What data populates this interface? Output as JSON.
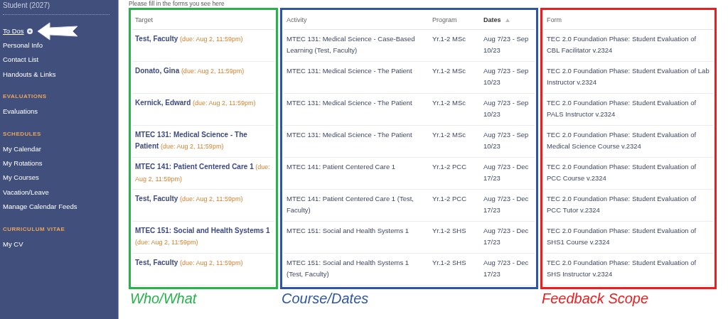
{
  "sidebar": {
    "user": "Student (2027)",
    "items": [
      {
        "kind": "badge-link",
        "label": "To Dos",
        "selected": true
      },
      {
        "kind": "link",
        "label": "Personal Info",
        "selected": false
      },
      {
        "kind": "link",
        "label": "Contact List",
        "selected": false
      },
      {
        "kind": "link",
        "label": "Handouts & Links",
        "selected": false
      },
      {
        "kind": "heading",
        "label": "EVALUATIONS"
      },
      {
        "kind": "link",
        "label": "Evaluations",
        "selected": false
      },
      {
        "kind": "heading",
        "label": "SCHEDULES"
      },
      {
        "kind": "link",
        "label": "My Calendar",
        "selected": false
      },
      {
        "kind": "link",
        "label": "My Rotations",
        "selected": false
      },
      {
        "kind": "link",
        "label": "My Courses",
        "selected": false
      },
      {
        "kind": "link",
        "label": "Vacation/Leave",
        "selected": false
      },
      {
        "kind": "link",
        "label": "Manage Calendar Feeds",
        "selected": false
      },
      {
        "kind": "heading",
        "label": "CURRICULUM VITAE"
      },
      {
        "kind": "link",
        "label": "My CV",
        "selected": false
      }
    ]
  },
  "intro": "Please fill in the forms you see here",
  "table": {
    "columns": [
      {
        "label": "Target",
        "sorted": false
      },
      {
        "label": "Activity",
        "sorted": false
      },
      {
        "label": "Program",
        "sorted": false
      },
      {
        "label": "Dates",
        "sorted": true
      },
      {
        "label": "Form",
        "sorted": false
      }
    ],
    "rows": [
      {
        "target": "Test, Faculty",
        "due": "(due: Aug 2, 11:59pm)",
        "activity": "MTEC 131: Medical Science - Case-Based Learning (Test, Faculty)",
        "program": "Yr.1-2 MSc",
        "dates": "Aug 7/23 - Sep 10/23",
        "form": "TEC 2.0 Foundation Phase: Student Evaluation of CBL Facilitator v.2324"
      },
      {
        "target": "Donato, Gina",
        "due": "(due: Aug 2, 11:59pm)",
        "activity": "MTEC 131: Medical Science - The Patient",
        "program": "Yr.1-2 MSc",
        "dates": "Aug 7/23 - Sep 10/23",
        "form": "TEC 2.0 Foundation Phase: Student Evaluation of Lab Instructor v.2324"
      },
      {
        "target": "Kernick, Edward",
        "due": "(due: Aug 2, 11:59pm)",
        "activity": "MTEC 131: Medical Science - The Patient",
        "program": "Yr.1-2 MSc",
        "dates": "Aug 7/23 - Sep 10/23",
        "form": "TEC 2.0 Foundation Phase: Student Evaluation of PALS Instructor v.2324"
      },
      {
        "target": "MTEC 131: Medical Science - The Patient",
        "due": "(due: Aug 2, 11:59pm)",
        "activity": "MTEC 131: Medical Science - The Patient",
        "program": "Yr.1-2 MSc",
        "dates": "Aug 7/23 - Sep 10/23",
        "form": "TEC 2.0 Foundation Phase: Student Evaluation of Medical Science Course v.2324"
      },
      {
        "target": "MTEC 141: Patient Centered Care 1",
        "due": "(due: Aug 2, 11:59pm)",
        "activity": "MTEC 141: Patient Centered Care 1",
        "program": "Yr.1-2 PCC",
        "dates": "Aug 7/23 - Dec 17/23",
        "form": "TEC 2.0 Foundation Phase: Student Evaluation of PCC Course v.2324"
      },
      {
        "target": "Test, Faculty",
        "due": "(due: Aug 2, 11:59pm)",
        "activity": "MTEC 141: Patient Centered Care 1 (Test, Faculty)",
        "program": "Yr.1-2 PCC",
        "dates": "Aug 7/23 - Dec 17/23",
        "form": "TEC 2.0 Foundation Phase: Student Evaluation of PCC Tutor v.2324"
      },
      {
        "target": "MTEC 151: Social and Health Systems 1",
        "due": "(due: Aug 2, 11:59pm)",
        "activity": "MTEC 151: Social and Health Systems 1",
        "program": "Yr.1-2 SHS",
        "dates": "Aug 7/23 - Dec 17/23",
        "form": "TEC 2.0 Foundation Phase: Student Evaluation of SHS1 Course v.2324"
      },
      {
        "target": "Test, Faculty",
        "due": "(due: Aug 2, 11:59pm)",
        "activity": "MTEC 151: Social and Health Systems 1 (Test, Faculty)",
        "program": "Yr.1-2 SHS",
        "dates": "Aug 7/23 - Dec 17/23",
        "form": "TEC 2.0 Foundation Phase: Student Evaluation of SHS Instructor v.2324"
      }
    ]
  },
  "annotations": [
    {
      "caption": "Who/What",
      "color": "#25b34a"
    },
    {
      "caption": "Course/Dates",
      "color": "#2f56a6"
    },
    {
      "caption": "Feedback Scope",
      "color": "#ee1c1c"
    }
  ]
}
